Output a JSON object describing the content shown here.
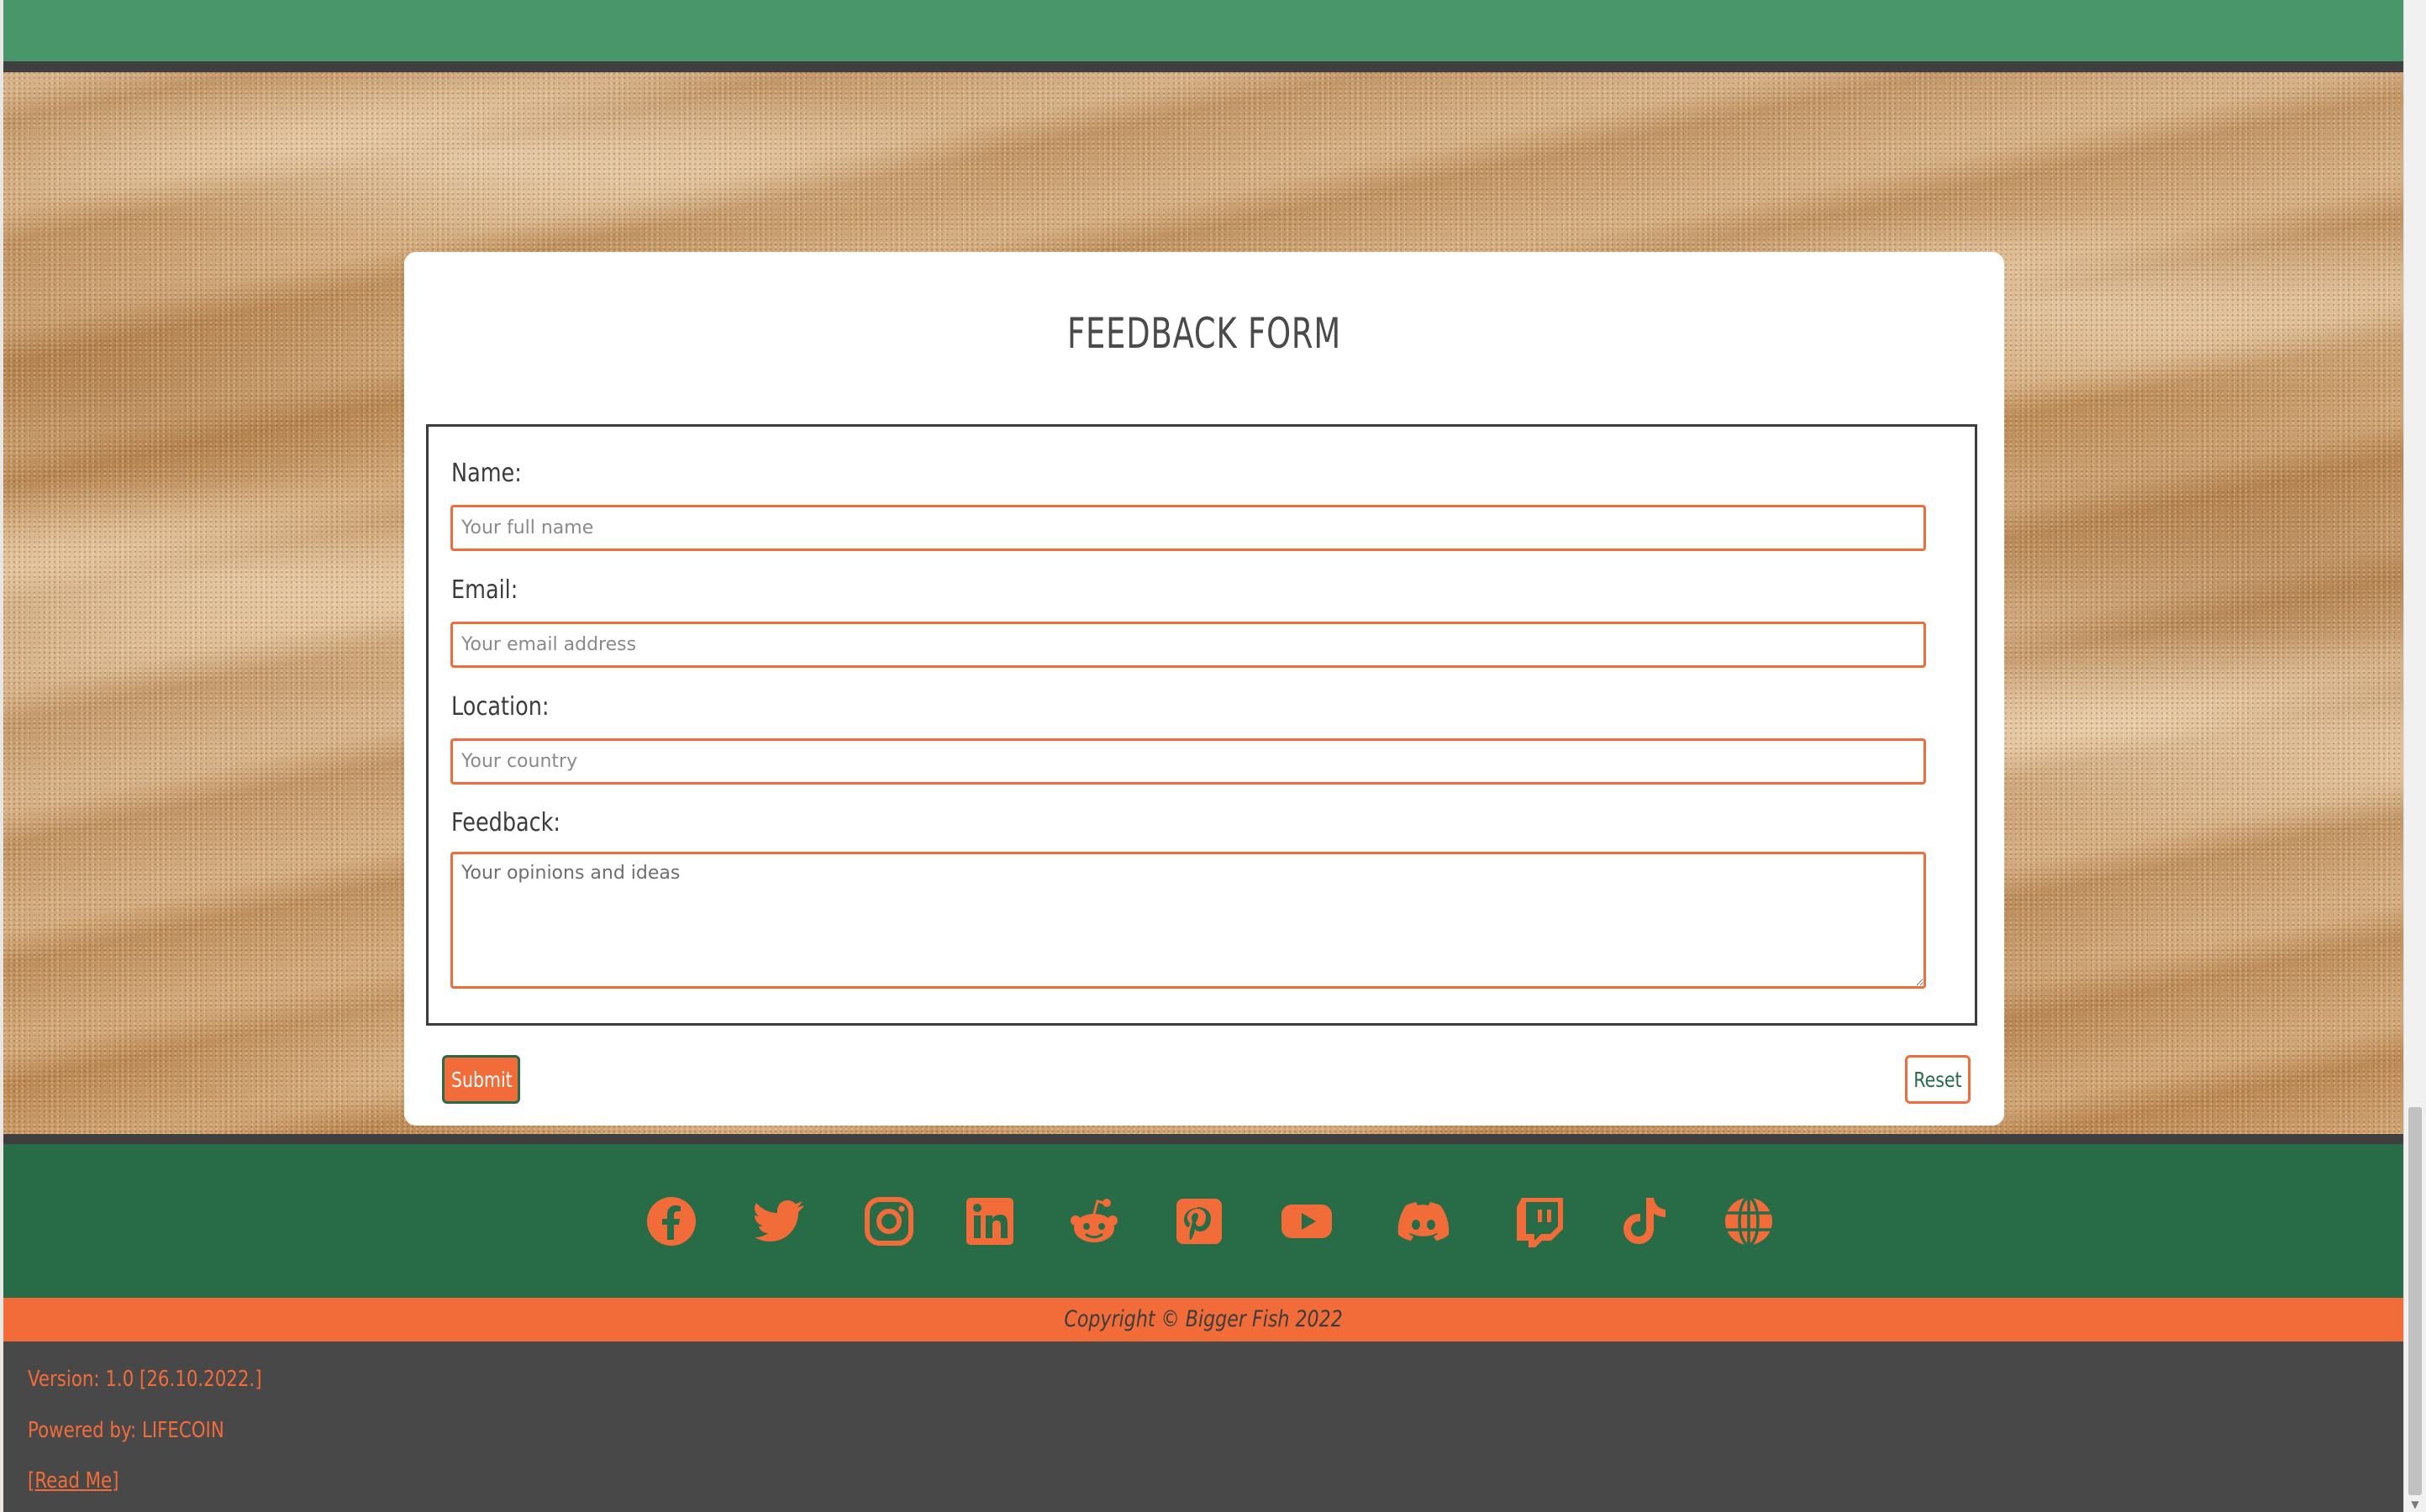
{
  "form": {
    "title": "FEEDBACK FORM",
    "fields": [
      {
        "label": "Name:",
        "placeholder": "Your full name",
        "value": ""
      },
      {
        "label": "Email:",
        "placeholder": "Your email address",
        "value": ""
      },
      {
        "label": "Location:",
        "placeholder": "Your country",
        "value": ""
      },
      {
        "label": "Feedback:",
        "placeholder": "Your opinions and ideas",
        "value": ""
      }
    ],
    "submit_label": "Submit",
    "reset_label": "Reset"
  },
  "social": {
    "icons": [
      "facebook-icon",
      "twitter-icon",
      "instagram-icon",
      "linkedin-icon",
      "reddit-icon",
      "pinterest-icon",
      "youtube-icon",
      "discord-icon",
      "twitch-icon",
      "tiktok-icon",
      "globe-icon"
    ]
  },
  "footer": {
    "copyright": "Copyright © Bigger Fish 2022",
    "version": "Version: 1.0 [26.10.2022.]",
    "powered_by": "Powered by: LIFECOIN",
    "readme_link": "[Read Me]"
  },
  "colors": {
    "header_green": "#4a966b",
    "footer_green": "#286b47",
    "accent_orange": "#f26c3a",
    "dark_gray": "#484848"
  }
}
